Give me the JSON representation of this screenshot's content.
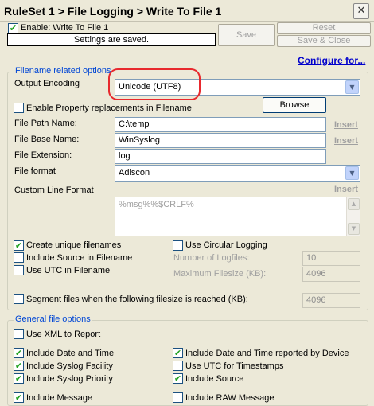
{
  "window": {
    "title": "RuleSet 1 > File Logging > Write To File 1",
    "close_glyph": "✕"
  },
  "header": {
    "enable_label": "Enable: Write To File 1",
    "enable_checked": true,
    "status": "Settings are saved.",
    "save_label": "Save",
    "reset_label": "Reset",
    "save_close_label": "Save & Close",
    "configure_link": "Configure for..."
  },
  "filename_group": {
    "title": "Filename related options",
    "output_encoding_label": "Output Encoding",
    "output_encoding_value": "Unicode (UTF8)",
    "property_repl_label": "Enable Property replacements in Filename",
    "property_repl_checked": false,
    "browse_label": "Browse",
    "file_path_label": "File Path Name:",
    "file_path_value": "C:\\temp",
    "file_base_label": "File Base Name:",
    "file_base_value": "WinSyslog",
    "file_ext_label": "File Extension:",
    "file_ext_value": "log",
    "file_format_label": "File format",
    "file_format_value": "Adiscon",
    "custom_line_label": "Custom Line Format",
    "custom_line_value": "%msg%%$CRLF%",
    "insert_label": "Insert",
    "create_unique_label": "Create unique filenames",
    "create_unique_checked": true,
    "include_source_fn_label": "Include Source in Filename",
    "include_source_fn_checked": false,
    "use_utc_fn_label": "Use UTC in Filename",
    "use_utc_fn_checked": false,
    "circular_label": "Use Circular Logging",
    "circular_checked": false,
    "num_logfiles_label": "Number of Logfiles:",
    "num_logfiles_value": "10",
    "max_filesize_label": "Maximum Filesize (KB):",
    "max_filesize_value": "4096",
    "segment_label": "Segment files when the following filesize is reached (KB):",
    "segment_checked": false,
    "segment_value": "4096"
  },
  "general_group": {
    "title": "General file options",
    "use_xml_label": "Use XML to Report",
    "use_xml_checked": false,
    "inc_date_label": "Include Date and Time",
    "inc_date_checked": true,
    "inc_facility_label": "Include Syslog Facility",
    "inc_facility_checked": true,
    "inc_priority_label": "Include Syslog Priority",
    "inc_priority_checked": true,
    "inc_message_label": "Include Message",
    "inc_message_checked": true,
    "inc_date_device_label": "Include Date and Time reported by Device",
    "inc_date_device_checked": true,
    "use_utc_ts_label": "Use UTC for Timestamps",
    "use_utc_ts_checked": false,
    "inc_source_label": "Include Source",
    "inc_source_checked": true,
    "inc_raw_label": "Include RAW Message",
    "inc_raw_checked": false
  },
  "icons": {
    "check": "✔",
    "dropdown": "▼",
    "scroll_up": "▲",
    "scroll_down": "▼"
  },
  "colors": {
    "group_title": "#0046d5",
    "link": "#0000cc",
    "highlight": "#e8292e",
    "check": "#21a121"
  }
}
